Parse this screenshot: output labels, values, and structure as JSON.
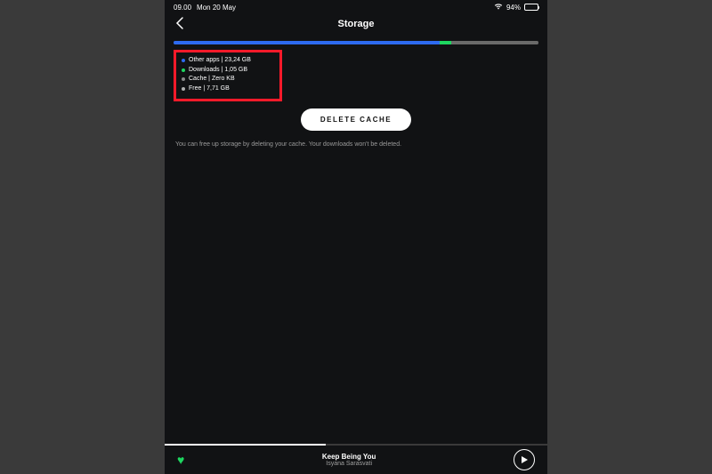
{
  "status": {
    "time": "09.00",
    "date": "Mon 20 May",
    "battery_pct": "94%"
  },
  "header": {
    "title": "Storage"
  },
  "storage": {
    "bar": {
      "other_pct": 73,
      "downloads_pct": 3,
      "cache_pct": 0,
      "free_pct": 24
    },
    "legend": [
      {
        "label": "Other apps",
        "value": "23,24 GB",
        "color": "blue"
      },
      {
        "label": "Downloads",
        "value": "1,05 GB",
        "color": "green"
      },
      {
        "label": "Cache",
        "value": "Zero KB",
        "color": "grey"
      },
      {
        "label": "Free",
        "value": "7,71 GB",
        "color": "lgrey"
      }
    ],
    "delete_label": "DELETE CACHE",
    "hint": "You can free up storage by deleting your cache. Your downloads won't be deleted."
  },
  "now_playing": {
    "title": "Keep Being You",
    "artist": "Isyana Sarasvati",
    "progress_pct": 42
  }
}
